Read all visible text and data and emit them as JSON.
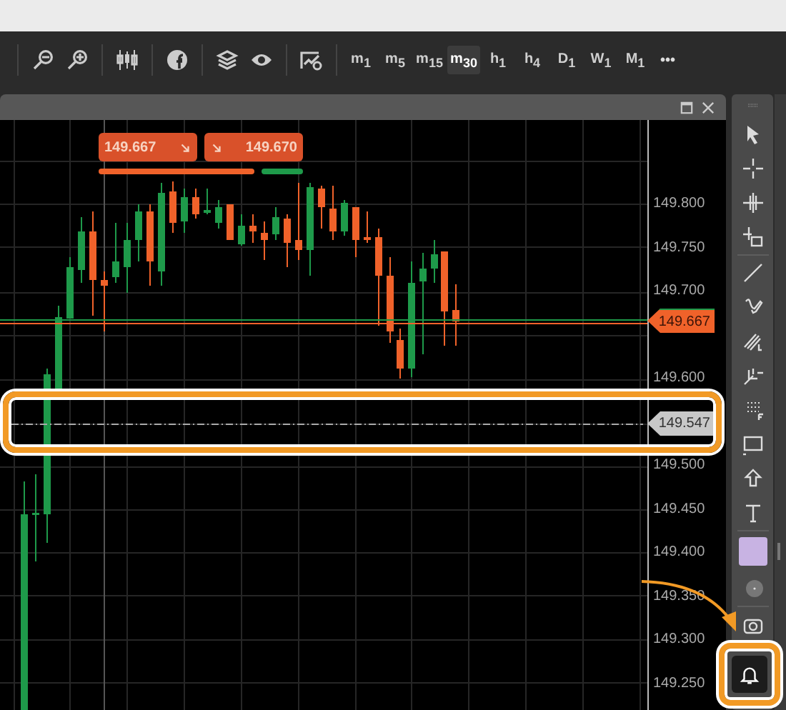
{
  "toolbar": {
    "timeframes": [
      {
        "label": "m$_{1}$",
        "selected": false
      },
      {
        "label": "m$_{5}$",
        "selected": false
      },
      {
        "label": "m$_{15}$",
        "selected": false
      },
      {
        "label": "m$_{30}$",
        "selected": true
      },
      {
        "label": "h$_{1}$",
        "selected": false
      },
      {
        "label": "h$_{4}$",
        "selected": false
      },
      {
        "label": "D$_{1}$",
        "selected": false
      },
      {
        "label": "W$_{1}$",
        "selected": false
      },
      {
        "label": "M$_{1}$",
        "selected": false
      }
    ],
    "more": "•••"
  },
  "chart_window": {
    "trade_panel": {
      "sell_price": "149.667",
      "buy_price": "149.670"
    },
    "price_axis": [
      "149.800",
      "149.750",
      "149.700",
      "149.600",
      "149.500",
      "149.450",
      "149.400",
      "149.350",
      "149.300",
      "149.250"
    ],
    "bid_tag": "149.667",
    "alert_line_tag": "149.547"
  }
}
